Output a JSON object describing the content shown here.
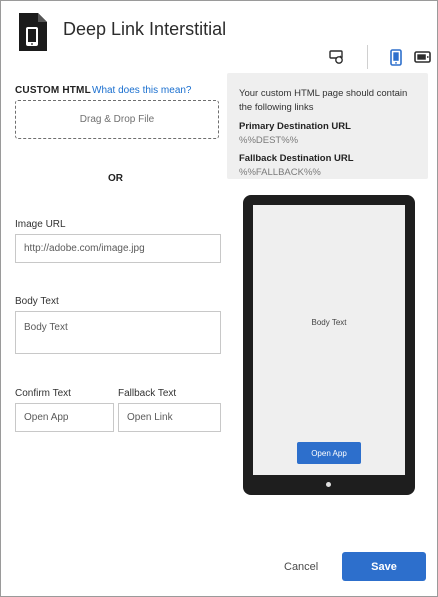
{
  "dialog": {
    "title": "Deep Link Interstitial",
    "icon": "file-phone-icon"
  },
  "toolbar": {
    "preview_modes": [
      {
        "name": "refresh-preview-icon",
        "active": false
      },
      {
        "name": "portrait-device-icon",
        "active": true
      },
      {
        "name": "landscape-device-icon",
        "active": false
      }
    ]
  },
  "form": {
    "custom_html_label": "CUSTOM HTML",
    "help_link": "What does this mean?",
    "dropzone_text": "Drag & Drop File",
    "or_text": "OR",
    "image_url": {
      "label": "Image URL",
      "placeholder": "http://adobe.com/image.jpg"
    },
    "body_text": {
      "label": "Body Text",
      "placeholder": "Body Text"
    },
    "confirm_text": {
      "label": "Confirm Text",
      "placeholder": "Open App"
    },
    "fallback_text": {
      "label": "Fallback Text",
      "placeholder": "Open Link"
    }
  },
  "info": {
    "line1": "Your custom HTML page should contain",
    "line2": "the following links",
    "primary_label": "Primary Destination URL",
    "primary_token": "%%DEST%%",
    "fallback_label": "Fallback Destination URL",
    "fallback_token": "%%FALLBACK%%"
  },
  "preview": {
    "body_text": "Body Text",
    "button_label": "Open App"
  },
  "footer": {
    "cancel_label": "Cancel",
    "save_label": "Save"
  },
  "colors": {
    "accent": "#2d6fcc",
    "link": "#1a6fcf",
    "info_bg": "#efefef",
    "device": "#1e1e1e"
  }
}
